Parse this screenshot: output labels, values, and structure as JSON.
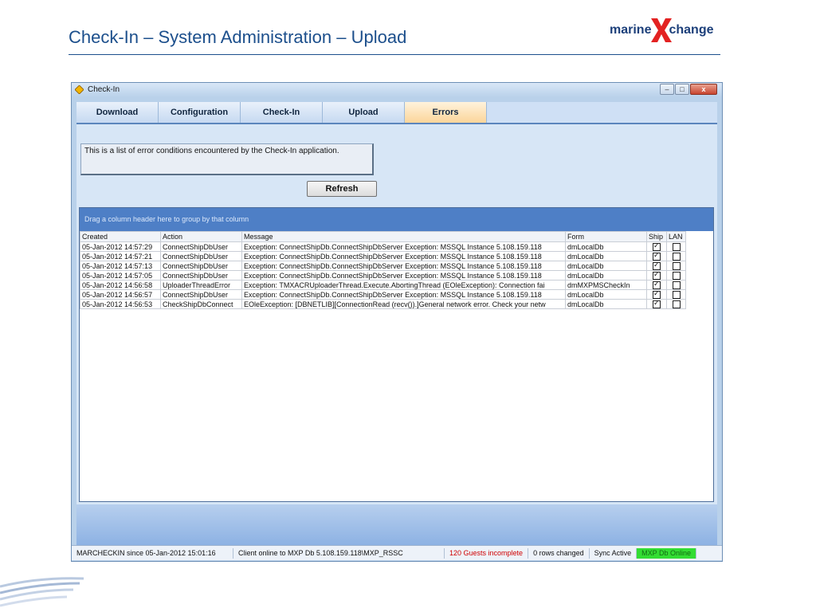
{
  "slide": {
    "title": "Check-In – System Administration – Upload",
    "logo": {
      "left": "marine",
      "mark": "X",
      "right": "change"
    }
  },
  "window": {
    "title": "Check-In",
    "buttons": {
      "minimize": "–",
      "maximize": "□",
      "close": "x"
    }
  },
  "tabs": [
    {
      "label": "Download"
    },
    {
      "label": "Configuration"
    },
    {
      "label": "Check-In"
    },
    {
      "label": "Upload"
    },
    {
      "label": "Errors"
    }
  ],
  "active_tab": "Errors",
  "notice": "This is a list of error conditions encountered by the Check-In application.",
  "refresh_label": "Refresh",
  "grid": {
    "group_hint": "Drag a column header here to group by that column",
    "columns": [
      "Created",
      "Action",
      "Message",
      "Form",
      "Ship",
      "LAN"
    ],
    "rows": [
      {
        "created": "05-Jan-2012 14:57:29",
        "action": "ConnectShipDbUser",
        "message": "Exception: ConnectShipDb.ConnectShipDbServer Exception: MSSQL Instance 5.108.159.118",
        "form": "dmLocalDb",
        "ship": true,
        "lan": false
      },
      {
        "created": "05-Jan-2012 14:57:21",
        "action": "ConnectShipDbUser",
        "message": "Exception: ConnectShipDb.ConnectShipDbServer Exception: MSSQL Instance 5.108.159.118",
        "form": "dmLocalDb",
        "ship": true,
        "lan": false
      },
      {
        "created": "05-Jan-2012 14:57:13",
        "action": "ConnectShipDbUser",
        "message": "Exception: ConnectShipDb.ConnectShipDbServer Exception: MSSQL Instance 5.108.159.118",
        "form": "dmLocalDb",
        "ship": true,
        "lan": false
      },
      {
        "created": "05-Jan-2012 14:57:05",
        "action": "ConnectShipDbUser",
        "message": "Exception: ConnectShipDb.ConnectShipDbServer Exception: MSSQL Instance 5.108.159.118",
        "form": "dmLocalDb",
        "ship": true,
        "lan": false
      },
      {
        "created": "05-Jan-2012 14:56:58",
        "action": "UploaderThreadError",
        "message": "Exception: TMXACRUploaderThread.Execute.AbortingThread (EOleException): Connection fai",
        "form": "dmMXPMSCheckIn",
        "ship": true,
        "lan": false
      },
      {
        "created": "05-Jan-2012 14:56:57",
        "action": "ConnectShipDbUser",
        "message": "Exception: ConnectShipDb.ConnectShipDbServer Exception: MSSQL Instance 5.108.159.118",
        "form": "dmLocalDb",
        "ship": true,
        "lan": false
      },
      {
        "created": "05-Jan-2012 14:56:53",
        "action": "CheckShipDbConnect",
        "message": "EOleException: [DBNETLIB][ConnectionRead (recv()).]General network error. Check your netw",
        "form": "dmLocalDb",
        "ship": true,
        "lan": false
      }
    ]
  },
  "statusbar": {
    "user": "MARCHECKIN since 05-Jan-2012 15:01:16",
    "connection": "Client online to MXP Db 5.108.159.118\\MXP_RSSC",
    "guests": "120 Guests incomplete",
    "rows": "0 rows changed",
    "sync": "Sync Active",
    "db": "MXP Db Online"
  },
  "colors": {
    "title": "#1c4f8c",
    "active_tab": "#fbd59a",
    "group_header": "#4e7fc6",
    "guests_text": "#d00000",
    "db_online": "#33dd33"
  }
}
